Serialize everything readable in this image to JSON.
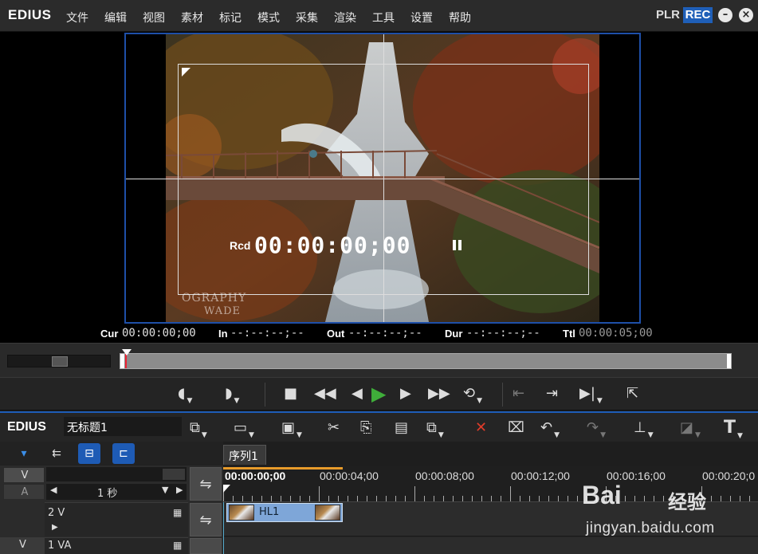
{
  "app": {
    "logo": "EDIUS",
    "menu": [
      "文件",
      "编辑",
      "视图",
      "素材",
      "标记",
      "模式",
      "采集",
      "渲染",
      "工具",
      "设置",
      "帮助"
    ],
    "plr": "PLR",
    "rec": "REC",
    "minimize": "–",
    "close": "×"
  },
  "preview": {
    "rcd_label": "Rcd",
    "rcd_timecode": "00:00:00;00",
    "watermark_line1": "OGRAPHY",
    "watermark_line2": "WADE"
  },
  "timecodes": {
    "cur_label": "Cur",
    "cur": "00:00:00;00",
    "in_label": "In",
    "in": "--:--:--;--",
    "out_label": "Out",
    "out": "--:--:--;--",
    "dur_label": "Dur",
    "dur": "--:--:--;--",
    "ttl_label": "Ttl",
    "ttl": "00:00:05;00"
  },
  "timeline": {
    "logo": "EDIUS",
    "project_name": "无标题1",
    "sequence_tab": "序列1",
    "ruler_current": "00:00:00;00",
    "ruler_marks": [
      "00:00:04;00",
      "00:00:08;00",
      "00:00:12;00",
      "00:00:16;00",
      "00:00:20;0"
    ],
    "scale_value": "1 秒",
    "track_v_letter": "V",
    "track_a_letter": "A",
    "tracks": [
      {
        "name": "2 V"
      },
      {
        "name": "1 VA"
      }
    ],
    "clip_name": "HL1"
  },
  "watermark": {
    "brand": "Bai 经验",
    "brand_latin": "Bai",
    "brand_cn": "经验",
    "url": "jingyan.baidu.com"
  }
}
